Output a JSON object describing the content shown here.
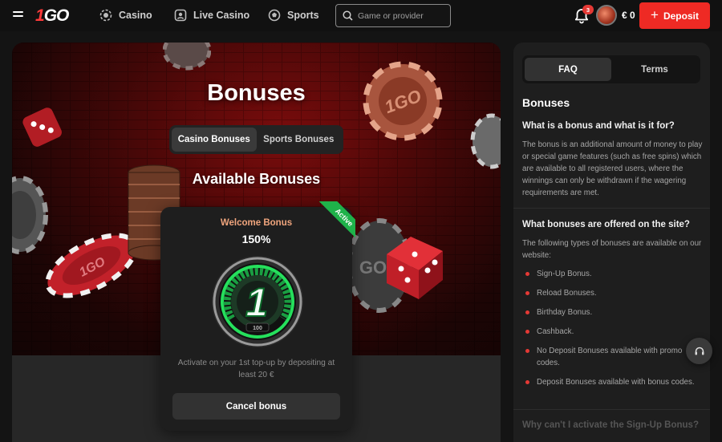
{
  "header": {
    "logo": {
      "one": "1",
      "go": "GO"
    },
    "nav": [
      {
        "label": "Casino",
        "icon": "casino-chip-icon"
      },
      {
        "label": "Live Casino",
        "icon": "live-casino-icon"
      },
      {
        "label": "Sports",
        "icon": "soccer-ball-icon"
      }
    ],
    "search_placeholder": "Game or provider",
    "notification_count": "3",
    "balance": "€ 0",
    "deposit_label": "Deposit"
  },
  "hero": {
    "title": "Bonuses",
    "tabs": [
      "Casino Bonuses",
      "Sports Bonuses"
    ],
    "available_title": "Available Bonuses"
  },
  "bonus_card": {
    "status": "Active",
    "name": "Welcome Bonus",
    "percent": "150%",
    "medal_number": "1",
    "medal_scale": "100",
    "description": "Activate on your 1st top-up by depositing at least 20 €",
    "cancel_label": "Cancel bonus"
  },
  "faq_panel": {
    "tabs": [
      "FAQ",
      "Terms"
    ],
    "heading": "Bonuses",
    "q1": "What is a bonus and what is it for?",
    "a1": "The bonus is an additional amount of money to play or special game features (such as free spins) which are available to all registered users, where the winnings can only be withdrawn if the wagering requirements are met.",
    "q2": "What bonuses are offered on the site?",
    "a2": "The following types of bonuses are available on our website:",
    "bonus_types": [
      "Sign-Up Bonus.",
      "Reload Bonuses.",
      "Birthday Bonus.",
      "Cashback.",
      "No Deposit Bonuses available with promo codes.",
      "Deposit Bonuses available with bonus codes."
    ],
    "q3": "Why can't I activate the Sign-Up Bonus?"
  },
  "colors": {
    "accent_red": "#ee2a24",
    "active_green": "#1fb24a",
    "bonus_orange": "#f0a57d"
  }
}
